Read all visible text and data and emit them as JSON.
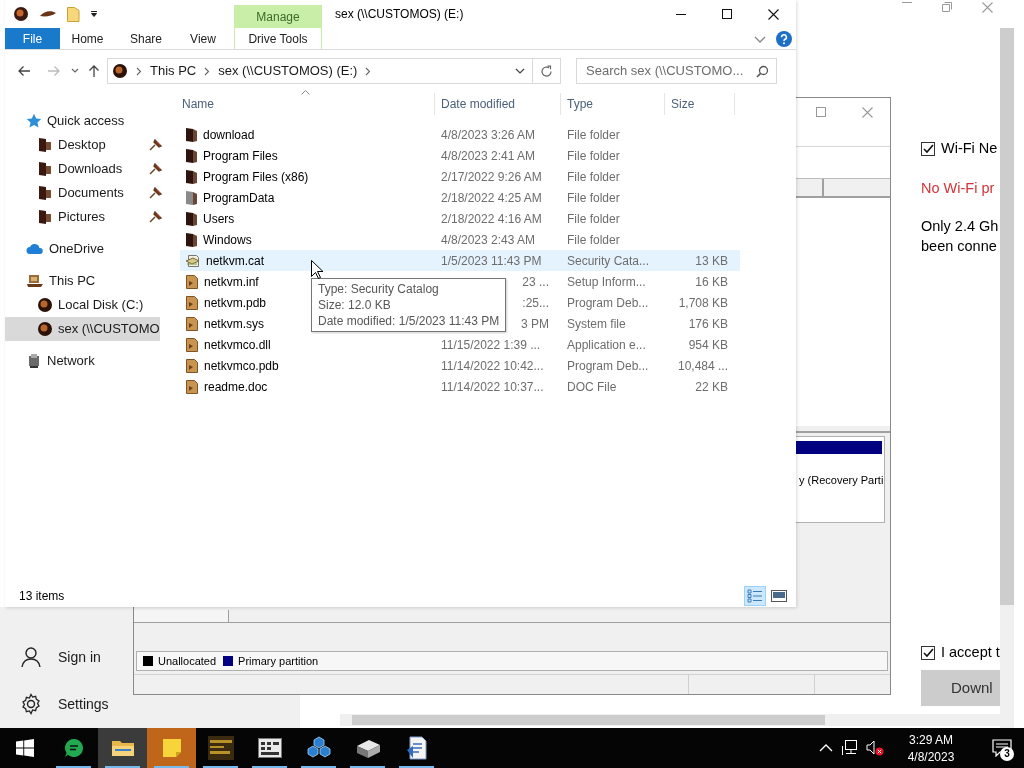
{
  "explorer": {
    "title": "sex (\\\\CUSTOMOS) (E:)",
    "context_tab": "Manage",
    "ribbon_tabs": [
      {
        "label": "File",
        "kind": "file",
        "selected": false
      },
      {
        "label": "Home",
        "kind": "tab",
        "selected": false
      },
      {
        "label": "Share",
        "kind": "tab",
        "selected": false
      },
      {
        "label": "View",
        "kind": "tab",
        "selected": false
      },
      {
        "label": "Drive Tools",
        "kind": "context",
        "selected": false
      }
    ],
    "breadcrumbs": [
      "This PC",
      "sex (\\\\CUSTOMOS) (E:)"
    ],
    "search": {
      "placeholder": "Search sex (\\\\CUSTOMO..."
    },
    "nav": [
      {
        "label": "Quick access",
        "kind": "star",
        "selected": false,
        "children": [
          {
            "label": "Desktop",
            "kind": "folder",
            "pinned": true,
            "selected": false
          },
          {
            "label": "Downloads",
            "kind": "folder",
            "pinned": true,
            "selected": false
          },
          {
            "label": "Documents",
            "kind": "folder",
            "pinned": true,
            "selected": false
          },
          {
            "label": "Pictures",
            "kind": "folder",
            "pinned": true,
            "selected": false
          }
        ]
      },
      {
        "label": "OneDrive",
        "kind": "cloud",
        "selected": false
      },
      {
        "label": "This PC",
        "kind": "pc",
        "selected": false,
        "children": [
          {
            "label": "Local Disk (C:)",
            "kind": "disk",
            "selected": false
          },
          {
            "label": "sex (\\\\CUSTOMO",
            "kind": "disk",
            "selected": true
          }
        ]
      },
      {
        "label": "Network",
        "kind": "network",
        "selected": false
      }
    ],
    "columns": [
      {
        "label": "Name",
        "sorted": true
      },
      {
        "label": "Date modified",
        "sorted": false
      },
      {
        "label": "Type",
        "sorted": false
      },
      {
        "label": "Size",
        "sorted": false
      }
    ],
    "rows": [
      {
        "name": "download",
        "date": "4/8/2023 3:26 AM",
        "type": "File folder",
        "kind": "folder",
        "hovered": false
      },
      {
        "name": "Program Files",
        "date": "4/8/2023 2:41 AM",
        "type": "File folder",
        "kind": "folder",
        "hovered": false
      },
      {
        "name": "Program Files (x86)",
        "date": "2/17/2022 9:26 AM",
        "type": "File folder",
        "kind": "folder",
        "hovered": false
      },
      {
        "name": "ProgramData",
        "date": "2/18/2022 4:25 AM",
        "type": "File folder",
        "kind": "folder",
        "faded": true,
        "hovered": false
      },
      {
        "name": "Users",
        "date": "2/18/2022 4:16 AM",
        "type": "File folder",
        "kind": "folder",
        "hovered": false
      },
      {
        "name": "Windows",
        "date": "4/8/2023 2:43 AM",
        "type": "File folder",
        "kind": "folder",
        "hovered": false
      },
      {
        "name": "netkvm.cat",
        "date": "1/5/2023 11:43 PM",
        "type": "Security Cata...",
        "size": "13 KB",
        "kind": "catalog",
        "hovered": true
      },
      {
        "name": "netkvm.inf",
        "date": "23 ...",
        "type": "Setup Inform...",
        "size": "16 KB",
        "kind": "file",
        "covered": true,
        "hovered": false
      },
      {
        "name": "netkvm.pdb",
        "date": ":25...",
        "type": "Program Deb...",
        "size": "1,708 KB",
        "kind": "file",
        "covered": true,
        "hovered": false
      },
      {
        "name": "netkvm.sys",
        "date": "3 PM",
        "type": "System file",
        "size": "176 KB",
        "kind": "file",
        "covered": true,
        "hovered": false
      },
      {
        "name": "netkvmco.dll",
        "date": "11/15/2022 1:39 ...",
        "type": "Application e...",
        "size": "954 KB",
        "kind": "file",
        "hovered": false
      },
      {
        "name": "netkvmco.pdb",
        "date": "11/14/2022 10:42...",
        "type": "Program Deb...",
        "size": "10,484 ...",
        "kind": "file",
        "hovered": false
      },
      {
        "name": "readme.doc",
        "date": "11/14/2022 10:37...",
        "type": "DOC File",
        "size": "22 KB",
        "kind": "file",
        "hovered": false
      }
    ],
    "tooltip": {
      "lines": [
        "Type: Security Catalog",
        "Size: 12.0 KB",
        "Date modified: 1/5/2023 11:43 PM"
      ]
    },
    "status": "13 items",
    "views": [
      {
        "kind": "details",
        "selected": true
      },
      {
        "kind": "large_icons",
        "selected": false
      }
    ]
  },
  "disk_management": {
    "partition_text": "y (Recovery Parti",
    "legend": [
      {
        "label": "Unallocated",
        "color": "#000000"
      },
      {
        "label": "Primary partition",
        "color": "#000080"
      }
    ]
  },
  "installer": {
    "option": {
      "label": "Wi-Fi Ne",
      "checked": true
    },
    "error": "No Wi-Fi pr",
    "info": [
      "Only 2.4 Gh",
      "been conne"
    ],
    "accept": {
      "label": "I accept t",
      "checked": true
    },
    "button": "Downl"
  },
  "start_menu": [
    {
      "label": "Sign in",
      "kind": "user"
    },
    {
      "label": "Settings",
      "kind": "settings"
    }
  ],
  "taskbar": {
    "apps": [
      {
        "kind": "chat",
        "active": false,
        "flashing": false
      },
      {
        "kind": "folder",
        "active": true,
        "flashing": false
      },
      {
        "kind": "note",
        "active": false,
        "flashing": true
      },
      {
        "kind": "calendar",
        "active": false,
        "flashing": false
      },
      {
        "kind": "window",
        "active": false,
        "flashing": false
      },
      {
        "kind": "cubes",
        "active": false,
        "flashing": false
      },
      {
        "kind": "drive",
        "active": false,
        "flashing": false
      },
      {
        "kind": "document",
        "active": false,
        "flashing": false
      }
    ],
    "clock": {
      "time": "3:29 AM",
      "date": "4/8/2023"
    },
    "notifications": "3"
  }
}
